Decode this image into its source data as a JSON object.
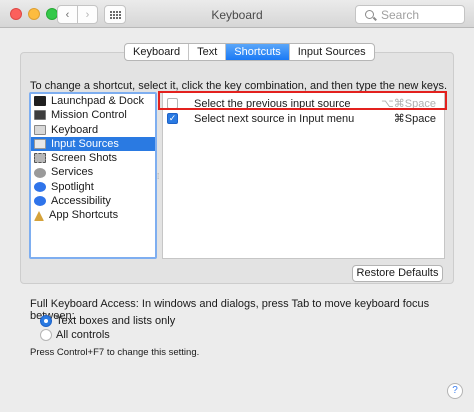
{
  "window": {
    "title": "Keyboard",
    "search_placeholder": "Search"
  },
  "toolbar": {
    "back_glyph": "‹",
    "forward_glyph": "›"
  },
  "tabs": [
    {
      "label": "Keyboard",
      "active": false
    },
    {
      "label": "Text",
      "active": false
    },
    {
      "label": "Shortcuts",
      "active": true
    },
    {
      "label": "Input Sources",
      "active": false
    }
  ],
  "instructions": "To change a shortcut, select it, click the key combination, and then type the new keys.",
  "categories": [
    {
      "label": "Launchpad & Dock",
      "icon": "launchpad-icon"
    },
    {
      "label": "Mission Control",
      "icon": "mission-control-icon"
    },
    {
      "label": "Keyboard",
      "icon": "keyboard-icon"
    },
    {
      "label": "Input Sources",
      "icon": "input-sources-icon",
      "selected": true
    },
    {
      "label": "Screen Shots",
      "icon": "screenshot-icon"
    },
    {
      "label": "Services",
      "icon": "gear-icon"
    },
    {
      "label": "Spotlight",
      "icon": "spotlight-icon"
    },
    {
      "label": "Accessibility",
      "icon": "accessibility-icon"
    },
    {
      "label": "App Shortcuts",
      "icon": "app-shortcuts-icon"
    }
  ],
  "shortcuts": [
    {
      "label": "Select the previous input source",
      "keys": "⌥⌘Space",
      "checked": false
    },
    {
      "label": "Select next source in Input menu",
      "keys": "⌘Space",
      "checked": true
    }
  ],
  "restore_label": "Restore Defaults",
  "full_keyboard_access": {
    "label": "Full Keyboard Access: In windows and dialogs, press Tab to move keyboard focus between:",
    "options": [
      {
        "label": "Text boxes and lists only",
        "selected": true
      },
      {
        "label": "All controls",
        "selected": false
      }
    ],
    "note": "Press Control+F7 to change this setting."
  },
  "help_glyph": "?",
  "checkmark_glyph": "✓",
  "colors": {
    "accent": "#2a7ae2",
    "highlight_box": "#e3211e"
  }
}
